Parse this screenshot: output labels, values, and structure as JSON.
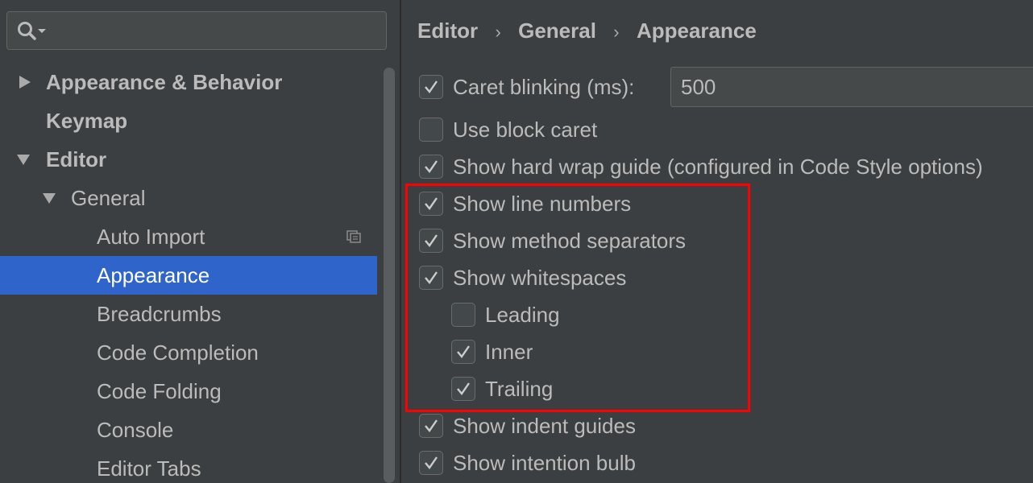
{
  "search": {
    "value": ""
  },
  "tree": {
    "items": [
      {
        "label": "Appearance & Behavior",
        "arrow": "right"
      },
      {
        "label": "Keymap"
      },
      {
        "label": "Editor",
        "arrow": "down"
      },
      {
        "label": "General",
        "arrow": "down"
      },
      {
        "label": "Auto Import",
        "icon": "copy-settings-icon"
      },
      {
        "label": "Appearance",
        "selected": true
      },
      {
        "label": "Breadcrumbs"
      },
      {
        "label": "Code Completion"
      },
      {
        "label": "Code Folding"
      },
      {
        "label": "Console"
      },
      {
        "label": "Editor Tabs"
      }
    ]
  },
  "breadcrumb": {
    "items": [
      "Editor",
      "General",
      "Appearance"
    ],
    "separator": "›"
  },
  "options": {
    "caret_blinking": {
      "label": "Caret blinking (ms):",
      "checked": true,
      "value": "500"
    },
    "use_block_caret": {
      "label": "Use block caret",
      "checked": false
    },
    "hard_wrap_guide": {
      "label": "Show hard wrap guide (configured in Code Style options)",
      "checked": true
    },
    "line_numbers": {
      "label": "Show line numbers",
      "checked": true
    },
    "method_separators": {
      "label": "Show method separators",
      "checked": true
    },
    "whitespaces": {
      "label": "Show whitespaces",
      "checked": true
    },
    "leading": {
      "label": "Leading",
      "checked": false
    },
    "inner": {
      "label": "Inner",
      "checked": true
    },
    "trailing": {
      "label": "Trailing",
      "checked": true
    },
    "indent_guides": {
      "label": "Show indent guides",
      "checked": true
    },
    "intention_bulb": {
      "label": "Show intention bulb",
      "checked": true
    }
  },
  "colors": {
    "background": "#3c3f41",
    "selection": "#2f65ca",
    "highlight": "#ff0000"
  }
}
